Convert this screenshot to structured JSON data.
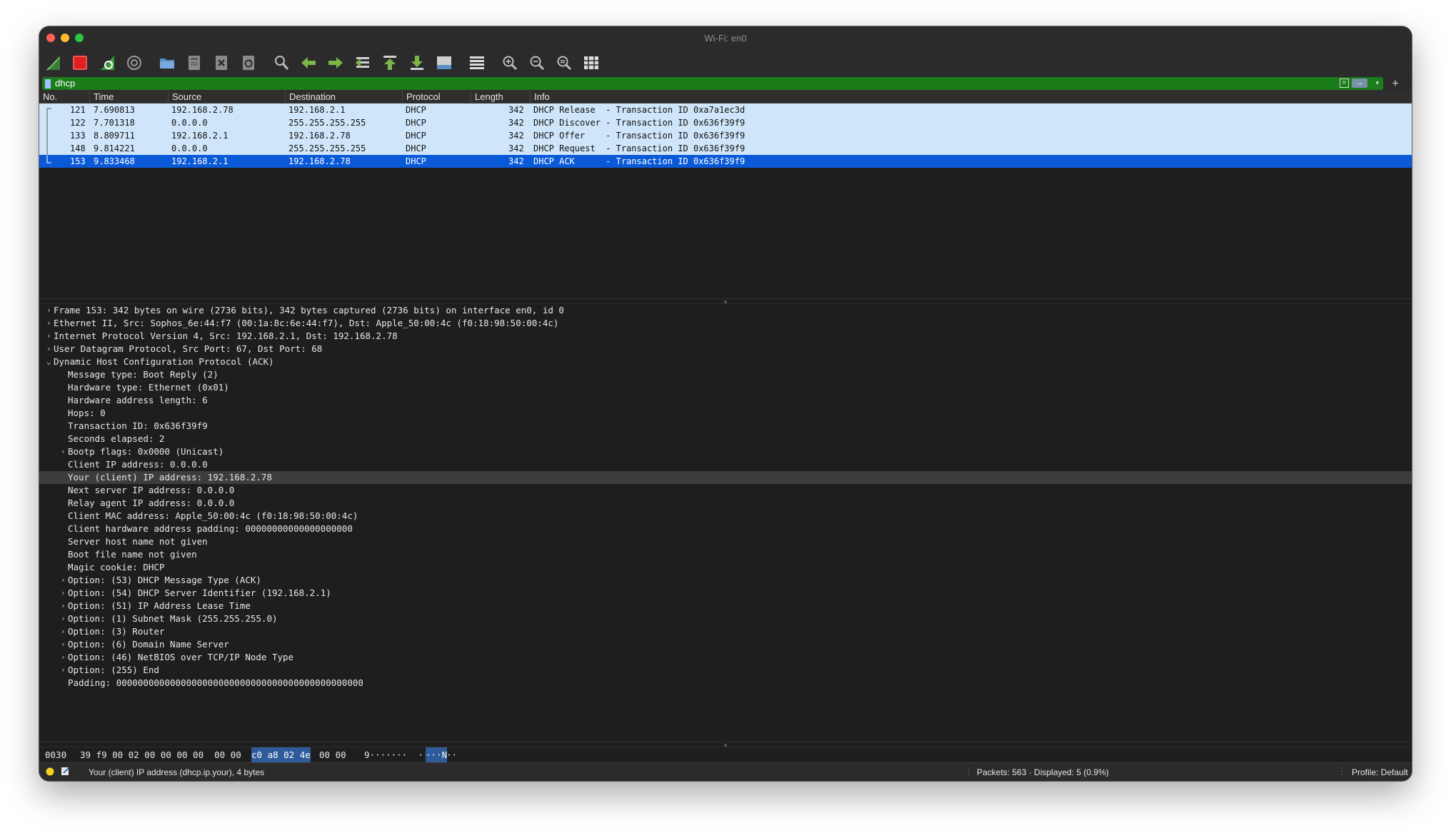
{
  "window": {
    "title": "Wi-Fi: en0"
  },
  "toolbar": {
    "buttons": [
      {
        "icon": "shark-fin-start-icon",
        "label": "Start capturing packets"
      },
      {
        "icon": "stop-square-icon",
        "label": "Stop capturing packets"
      },
      {
        "icon": "restart-fin-icon",
        "label": "Restart current capture"
      },
      {
        "icon": "gear-options-icon",
        "label": "Capture options"
      },
      {
        "icon": "open-folder-icon",
        "label": "Open"
      },
      {
        "icon": "save-file-icon",
        "label": "Save"
      },
      {
        "icon": "close-file-icon",
        "label": "Close"
      },
      {
        "icon": "reload-file-icon",
        "label": "Reload"
      },
      {
        "icon": "find-magnifier-icon",
        "label": "Find"
      },
      {
        "icon": "go-back-arrow-icon",
        "label": "Back"
      },
      {
        "icon": "go-forward-arrow-icon",
        "label": "Forward"
      },
      {
        "icon": "go-to-packet-icon",
        "label": "Go to packet"
      },
      {
        "icon": "first-packet-icon",
        "label": "First packet"
      },
      {
        "icon": "last-packet-icon",
        "label": "Last packet"
      },
      {
        "icon": "autoscroll-icon",
        "label": "Auto scroll"
      },
      {
        "icon": "colorize-icon",
        "label": "Colorize"
      },
      {
        "icon": "zoom-in-icon",
        "label": "Zoom in"
      },
      {
        "icon": "zoom-out-icon",
        "label": "Zoom out"
      },
      {
        "icon": "zoom-reset-icon",
        "label": "Normal size"
      },
      {
        "icon": "resize-columns-icon",
        "label": "Resize columns"
      }
    ]
  },
  "filter": {
    "value": "dhcp",
    "clear_icon": "clear-x-icon",
    "apply_icon": "apply-arrow-icon",
    "add_label": "+"
  },
  "packet_list": {
    "columns": [
      "No.",
      "Time",
      "Source",
      "Destination",
      "Protocol",
      "Length",
      "Info"
    ],
    "rows": [
      {
        "no": "121",
        "time": "7.690813",
        "source": "192.168.2.78",
        "destination": "192.168.2.1",
        "protocol": "DHCP",
        "length": "342",
        "info": "DHCP Release  - Transaction ID 0xa7a1ec3d"
      },
      {
        "no": "122",
        "time": "7.701318",
        "source": "0.0.0.0",
        "destination": "255.255.255.255",
        "protocol": "DHCP",
        "length": "342",
        "info": "DHCP Discover - Transaction ID 0x636f39f9"
      },
      {
        "no": "133",
        "time": "8.809711",
        "source": "192.168.2.1",
        "destination": "192.168.2.78",
        "protocol": "DHCP",
        "length": "342",
        "info": "DHCP Offer    - Transaction ID 0x636f39f9"
      },
      {
        "no": "148",
        "time": "9.814221",
        "source": "0.0.0.0",
        "destination": "255.255.255.255",
        "protocol": "DHCP",
        "length": "342",
        "info": "DHCP Request  - Transaction ID 0x636f39f9"
      },
      {
        "no": "153",
        "time": "9.833468",
        "source": "192.168.2.1",
        "destination": "192.168.2.78",
        "protocol": "DHCP",
        "length": "342",
        "info": "DHCP ACK      - Transaction ID 0x636f39f9"
      }
    ],
    "selected_index": 4
  },
  "details": {
    "lines": [
      {
        "text": "Frame 153: 342 bytes on wire (2736 bits), 342 bytes captured (2736 bits) on interface en0, id 0",
        "level": 0,
        "expander": "collapsed"
      },
      {
        "text": "Ethernet II, Src: Sophos_6e:44:f7 (00:1a:8c:6e:44:f7), Dst: Apple_50:00:4c (f0:18:98:50:00:4c)",
        "level": 0,
        "expander": "collapsed"
      },
      {
        "text": "Internet Protocol Version 4, Src: 192.168.2.1, Dst: 192.168.2.78",
        "level": 0,
        "expander": "collapsed"
      },
      {
        "text": "User Datagram Protocol, Src Port: 67, Dst Port: 68",
        "level": 0,
        "expander": "collapsed"
      },
      {
        "text": "Dynamic Host Configuration Protocol (ACK)",
        "level": 0,
        "expander": "expanded"
      },
      {
        "text": "Message type: Boot Reply (2)",
        "level": 1,
        "expander": "none"
      },
      {
        "text": "Hardware type: Ethernet (0x01)",
        "level": 1,
        "expander": "none"
      },
      {
        "text": "Hardware address length: 6",
        "level": 1,
        "expander": "none"
      },
      {
        "text": "Hops: 0",
        "level": 1,
        "expander": "none"
      },
      {
        "text": "Transaction ID: 0x636f39f9",
        "level": 1,
        "expander": "none"
      },
      {
        "text": "Seconds elapsed: 2",
        "level": 1,
        "expander": "none"
      },
      {
        "text": "Bootp flags: 0x0000 (Unicast)",
        "level": 1,
        "expander": "collapsed"
      },
      {
        "text": "Client IP address: 0.0.0.0",
        "level": 1,
        "expander": "none"
      },
      {
        "text": "Your (client) IP address: 192.168.2.78",
        "level": 1,
        "expander": "none",
        "selected": true
      },
      {
        "text": "Next server IP address: 0.0.0.0",
        "level": 1,
        "expander": "none"
      },
      {
        "text": "Relay agent IP address: 0.0.0.0",
        "level": 1,
        "expander": "none"
      },
      {
        "text": "Client MAC address: Apple_50:00:4c (f0:18:98:50:00:4c)",
        "level": 1,
        "expander": "none"
      },
      {
        "text": "Client hardware address padding: 00000000000000000000",
        "level": 1,
        "expander": "none"
      },
      {
        "text": "Server host name not given",
        "level": 1,
        "expander": "none"
      },
      {
        "text": "Boot file name not given",
        "level": 1,
        "expander": "none"
      },
      {
        "text": "Magic cookie: DHCP",
        "level": 1,
        "expander": "none"
      },
      {
        "text": "Option: (53) DHCP Message Type (ACK)",
        "level": 1,
        "expander": "collapsed"
      },
      {
        "text": "Option: (54) DHCP Server Identifier (192.168.2.1)",
        "level": 1,
        "expander": "collapsed"
      },
      {
        "text": "Option: (51) IP Address Lease Time",
        "level": 1,
        "expander": "collapsed"
      },
      {
        "text": "Option: (1) Subnet Mask (255.255.255.0)",
        "level": 1,
        "expander": "collapsed"
      },
      {
        "text": "Option: (3) Router",
        "level": 1,
        "expander": "collapsed"
      },
      {
        "text": "Option: (6) Domain Name Server",
        "level": 1,
        "expander": "collapsed"
      },
      {
        "text": "Option: (46) NetBIOS over TCP/IP Node Type",
        "level": 1,
        "expander": "collapsed"
      },
      {
        "text": "Option: (255) End",
        "level": 1,
        "expander": "collapsed"
      },
      {
        "text": "Padding: 0000000000000000000000000000000000000000000000",
        "level": 1,
        "expander": "none"
      }
    ]
  },
  "bytes_pane": {
    "offset": "0030",
    "hex_before": "39 f9 00 02 00 00 00 00  00 00",
    "hex_selected": "c0 a8 02 4e",
    "hex_after": "00 00",
    "ascii_before": "9·······  ··",
    "ascii_selected": "···N",
    "ascii_after": "··"
  },
  "status": {
    "field_info": "Your (client) IP address (dhcp.ip.your), 4 bytes",
    "packets": "Packets: 563 · Displayed: 5 (0.9%)",
    "profile": "Profile: Default"
  },
  "colors": {
    "row_bg": "#cfe6fa",
    "selected_row_bg": "#0a5ad8",
    "filter_valid_bg": "#1a7d1a",
    "window_bg": "#1e1e1e"
  }
}
